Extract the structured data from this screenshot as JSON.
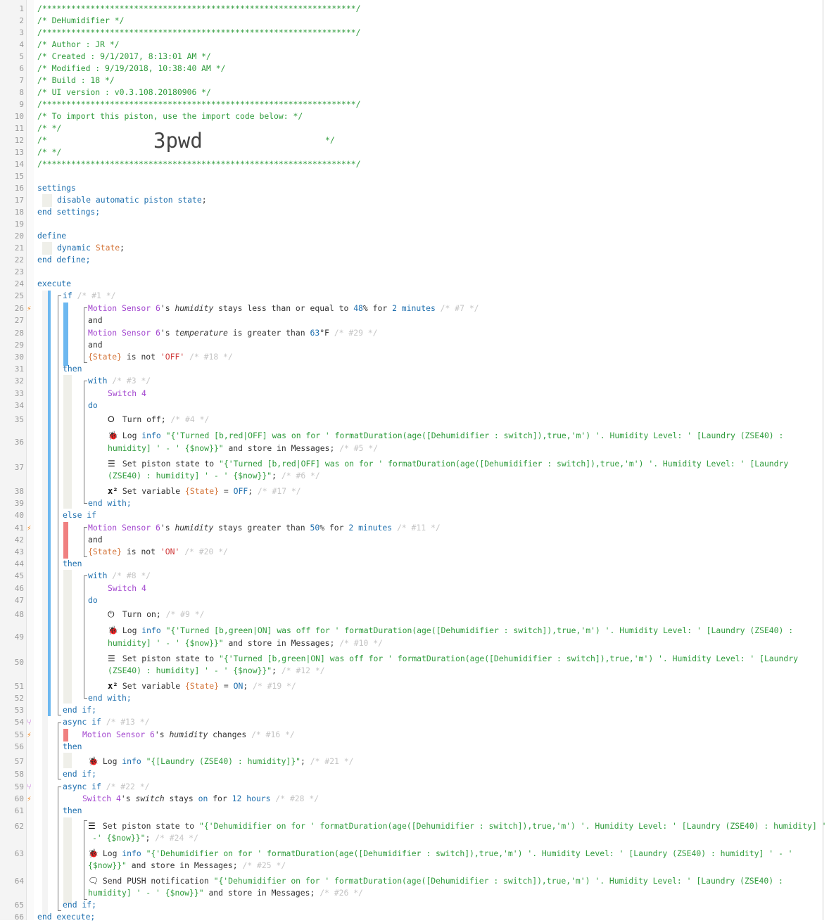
{
  "header": {
    "stars": "/*****************************************************************/",
    "title": "/* DeHumidifier                                                  */",
    "author": "/* Author     : JR                                               */",
    "created": "/* Created    : 9/1/2017, 8:13:01 AM                             */",
    "modified": "/* Modified   : 9/19/2018, 10:38:40 AM                           */",
    "build": "/* Build      : 18                                               */",
    "ui_version": "/* UI version : v0.3.108.20180906                               */",
    "import_note": "/* To import this piston, use the import code below:           */",
    "blank": "/*                                                               */",
    "code_prefix": "/*",
    "import_code": "3pwd",
    "code_suffix": "*/"
  },
  "kw": {
    "settings": "settings",
    "disable": "disable automatic piston state",
    "end_settings": "end settings;",
    "define": "define",
    "dynamic": "dynamic",
    "state_var_name": "State",
    "end_define": "end define;",
    "execute": "execute",
    "if": "if",
    "then": "then",
    "else_if": "else if",
    "and": "and",
    "with": "with",
    "do": "do",
    "end_with": "end with;",
    "end_if": "end if;",
    "async_if": "async if",
    "end_execute": "end execute;",
    "semi": ";"
  },
  "devices": {
    "motion": "Motion Sensor 6",
    "switch": "Switch 4",
    "switch_poss": "Switch 4"
  },
  "attrs": {
    "humidity": "humidity",
    "temperature": "temperature",
    "switch": "switch"
  },
  "vars": {
    "state": "{State}"
  },
  "conditions": {
    "c7_text": "'s ",
    "c7_op": " stays less than or equal to ",
    "c7_val": "48",
    "c7_unit": "% for ",
    "c7_dur": "2",
    "c7_dur_unit": " minutes",
    "c7_id": "/* #7 */",
    "c29_op": " is greater than ",
    "c29_val": "63",
    "c29_unit": "°F",
    "c29_id": "/* #29 */",
    "c18_op": " is not ",
    "c18_val": "'OFF'",
    "c18_id": "/* #18 */",
    "c11_op": " stays greater than ",
    "c11_val": "50",
    "c11_unit": "% for ",
    "c11_dur": "2",
    "c11_dur_unit": " minutes",
    "c11_id": "/* #11 */",
    "c20_op": " is not ",
    "c20_val": "'ON'",
    "c20_id": "/* #20 */",
    "c16_op": " changes",
    "c16_id": "/* #16 */",
    "c28_op": " stays ",
    "c28_val": "on",
    "c28_for": " for ",
    "c28_dur": "12",
    "c28_dur_unit": " hours",
    "c28_id": "/* #28 */"
  },
  "ids": {
    "if1": "/* #1 */",
    "with3": "/* #3 */",
    "with8": "/* #8 */",
    "async13": "/* #13 */",
    "async22": "/* #22 */"
  },
  "statements": {
    "turn_off": "Turn off;",
    "turn_off_id": "/* #4 */",
    "log": "Log ",
    "info": "info",
    "log5_a": " \"{'Turned [b,red|OFF] was on for ' formatDuration(age([Dehumidifier : switch]),true,'m') '. Humidity Level: ' [Laundry (ZSE40) :",
    "log5_b": "humidity] ' - ' {$now}}\"",
    "store": " and store in Messages;",
    "log5_id": "/* #5 */",
    "set_state": "Set piston state to ",
    "ps6_a": "\"{'Turned [b,red|OFF] was on for ' formatDuration(age([Dehumidifier : switch]),true,'m') '. Humidity Level: ' [Laundry",
    "ps6_b": "(ZSE40) : humidity] ' - ' {$now}}\"",
    "ps6_id": "/* #6 */",
    "set_var": "Set variable ",
    "eq": " = ",
    "off_val": "OFF",
    "sv17_id": "/* #17 */",
    "turn_on": "Turn on;",
    "turn_on_id": "/* #9 */",
    "log10_a": " \"{'Turned [b,green|ON] was off for ' formatDuration(age([Dehumidifier : switch]),true,'m') '. Humidity Level: ' [Laundry (ZSE40) :",
    "log10_b": "humidity] ' - ' {$now}}\"",
    "log10_id": "/* #10 */",
    "ps12_a": "\"{'Turned [b,green|ON] was off for ' formatDuration(age([Dehumidifier : switch]),true,'m') '. Humidity Level: ' [Laundry",
    "ps12_b": "(ZSE40) : humidity] ' - ' {$now}}\"",
    "ps12_id": "/* #12 */",
    "on_val": "ON",
    "sv19_id": "/* #19 */",
    "log21": " \"{[Laundry (ZSE40) : humidity]}\"",
    "log21_id": "/* #21 */",
    "ps24_a": "\"{'Dehumidifier on for ' formatDuration(age([Dehumidifier : switch]),true,'m') '. Humidity Level: ' [Laundry (ZSE40) : humidity] '",
    "ps24_b": "-' {$now}}\"",
    "ps24_id": "/* #24 */",
    "log25_a": " \"{'Dehumidifier on for ' formatDuration(age([Dehumidifier : switch]),true,'m') '. Humidity Level: ' [Laundry (ZSE40) : humidity] ' - '",
    "log25_b": "{$now}}\"",
    "log25_id": "/* #25 */",
    "push": "Send PUSH notification ",
    "push26_a": "\"{'Dehumidifier on for ' formatDuration(age([Dehumidifier : switch]),true,'m') '. Humidity Level: ' [Laundry (ZSE40) :",
    "push26_b": "humidity] ' - ' {$now}}\"",
    "push26_id": "/* #26 */"
  },
  "line_numbers": [
    "1",
    "2",
    "3",
    "4",
    "5",
    "6",
    "7",
    "8",
    "9",
    "10",
    "11",
    "12",
    "13",
    "14",
    "15",
    "16",
    "17",
    "18",
    "19",
    "20",
    "21",
    "22",
    "23",
    "24",
    "25",
    "26",
    "27",
    "28",
    "29",
    "30",
    "31",
    "32",
    "33",
    "34",
    "35",
    "36",
    "37",
    "38",
    "39",
    "40",
    "41",
    "42",
    "43",
    "44",
    "45",
    "46",
    "47",
    "48",
    "49",
    "50",
    "51",
    "52",
    "53",
    "54",
    "55",
    "56",
    "57",
    "58",
    "59",
    "60",
    "61",
    "62",
    "63",
    "64",
    "65",
    "66"
  ],
  "colors": {
    "comment": "#2e9b3b",
    "keyword": "#1e6fae",
    "device": "#a347cf",
    "variable": "#d4763b",
    "if_bar": "#6db8f0",
    "else_bar": "#f08080"
  }
}
